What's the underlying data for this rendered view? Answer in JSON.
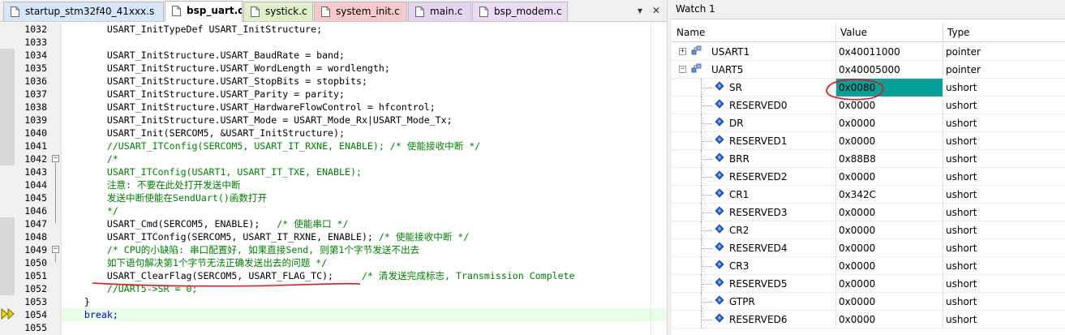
{
  "editor": {
    "tabs": [
      {
        "label": "startup_stm32f40_41xxx.s",
        "color": "#d7e6fa",
        "active": false
      },
      {
        "label": "bsp_uart.c",
        "color": "#fcf39a",
        "active": true
      },
      {
        "label": "systick.c",
        "color": "#dff0c8",
        "active": false
      },
      {
        "label": "system_init.c",
        "color": "#f8c9cc",
        "active": false
      },
      {
        "label": "main.c",
        "color": "#e3d4ef",
        "active": false
      },
      {
        "label": "bsp_modem.c",
        "color": "#ecdcf3",
        "active": false
      }
    ],
    "tab_dropdown_glyph": "▾",
    "tab_close_glyph": "✕",
    "lines": [
      {
        "no": "1032",
        "text": "        USART_InitTypeDef USART_InitStructure;",
        "style": "normal"
      },
      {
        "no": "1033",
        "text": "",
        "style": "normal"
      },
      {
        "no": "1034",
        "text": "        USART_InitStructure.USART_BaudRate = band;",
        "style": "normal"
      },
      {
        "no": "1035",
        "text": "        USART_InitStructure.USART_WordLength = wordlength;",
        "style": "normal"
      },
      {
        "no": "1036",
        "text": "        USART_InitStructure.USART_StopBits = stopbits;",
        "style": "normal"
      },
      {
        "no": "1037",
        "text": "        USART_InitStructure.USART_Parity = parity;",
        "style": "normal"
      },
      {
        "no": "1038",
        "text": "        USART_InitStructure.USART_HardwareFlowControl = hfcontrol;",
        "style": "normal"
      },
      {
        "no": "1039",
        "text": "        USART_InitStructure.USART_Mode = USART_Mode_Rx|USART_Mode_Tx;",
        "style": "normal"
      },
      {
        "no": "1040",
        "text": "        USART_Init(SERCOM5, &USART_InitStructure);",
        "style": "normal"
      },
      {
        "no": "1041",
        "text": "        //USART_ITConfig(SERCOM5, USART_IT_RXNE, ENABLE); /* 使能接收中断 */",
        "style": "comment"
      },
      {
        "no": "1042",
        "text": "        /*",
        "style": "comment"
      },
      {
        "no": "1043",
        "text": "        USART_ITConfig(USART1, USART_IT_TXE, ENABLE);",
        "style": "comment"
      },
      {
        "no": "1044",
        "text": "        注意: 不要在此处打开发送中断",
        "style": "comment"
      },
      {
        "no": "1045",
        "text": "        发送中断使能在SendUart()函数打开",
        "style": "comment"
      },
      {
        "no": "1046",
        "text": "        */",
        "style": "comment"
      },
      {
        "no": "1047",
        "text": "        USART_Cmd(SERCOM5, ENABLE);   /* 使能串口 */",
        "style": "mixed",
        "code": "        USART_Cmd(SERCOM5, ENABLE);   ",
        "comment": "/* 使能串口 */"
      },
      {
        "no": "1048",
        "text": "        USART_ITConfig(SERCOM5, USART_IT_RXNE, ENABLE); /* 使能接收中断 */",
        "style": "mixed",
        "code": "        USART_ITConfig(SERCOM5, USART_IT_RXNE, ENABLE); ",
        "comment": "/* 使能接收中断 */"
      },
      {
        "no": "1049",
        "text": "        /* CPU的小缺陷: 串口配置好, 如果直接Send, 则第1个字节发送不出去",
        "style": "comment"
      },
      {
        "no": "1050",
        "text": "        如下语句解决第1个字节无法正确发送出去的问题 */",
        "style": "comment"
      },
      {
        "no": "1051",
        "text": "        USART_ClearFlag(SERCOM5, USART_FLAG_TC);     /* 清发送完成标志, Transmission Complete",
        "style": "mixed",
        "code": "        USART_ClearFlag(SERCOM5, USART_FLAG_TC);     ",
        "comment": "/* 清发送完成标志, Transmission Complete"
      },
      {
        "no": "1052",
        "text": "        //UART5->SR = 0;",
        "style": "comment"
      },
      {
        "no": "1053",
        "text": "    }",
        "style": "normal"
      },
      {
        "no": "1054",
        "text": "    break;",
        "style": "keyword"
      },
      {
        "no": "1055",
        "text": "",
        "style": "normal"
      }
    ]
  },
  "watch": {
    "title": "Watch 1",
    "columns": {
      "name": "Name",
      "value": "Value",
      "type": "Type"
    },
    "rows": [
      {
        "name": "USART1",
        "value": "0x40011000",
        "type": "pointer",
        "level": 0,
        "expander": "+"
      },
      {
        "name": "UART5",
        "value": "0x40005000",
        "type": "pointer",
        "level": 0,
        "expander": "−"
      },
      {
        "name": "SR",
        "value": "0x0080",
        "type": "ushort",
        "level": 1,
        "selected": true
      },
      {
        "name": "RESERVED0",
        "value": "0x0000",
        "type": "ushort",
        "level": 1
      },
      {
        "name": "DR",
        "value": "0x0000",
        "type": "ushort",
        "level": 1
      },
      {
        "name": "RESERVED1",
        "value": "0x0000",
        "type": "ushort",
        "level": 1
      },
      {
        "name": "BRR",
        "value": "0x88B8",
        "type": "ushort",
        "level": 1
      },
      {
        "name": "RESERVED2",
        "value": "0x0000",
        "type": "ushort",
        "level": 1
      },
      {
        "name": "CR1",
        "value": "0x342C",
        "type": "ushort",
        "level": 1
      },
      {
        "name": "RESERVED3",
        "value": "0x0000",
        "type": "ushort",
        "level": 1
      },
      {
        "name": "CR2",
        "value": "0x0000",
        "type": "ushort",
        "level": 1
      },
      {
        "name": "RESERVED4",
        "value": "0x0000",
        "type": "ushort",
        "level": 1
      },
      {
        "name": "CR3",
        "value": "0x0000",
        "type": "ushort",
        "level": 1
      },
      {
        "name": "RESERVED5",
        "value": "0x0000",
        "type": "ushort",
        "level": 1
      },
      {
        "name": "GTPR",
        "value": "0x0000",
        "type": "ushort",
        "level": 1
      },
      {
        "name": "RESERVED6",
        "value": "0x0000",
        "type": "ushort",
        "level": 1
      }
    ]
  },
  "colors": {
    "comment": "#008000",
    "keyword": "#0000ff",
    "selected_value_bg": "#009f97",
    "annotation_red": "#e0151b"
  }
}
